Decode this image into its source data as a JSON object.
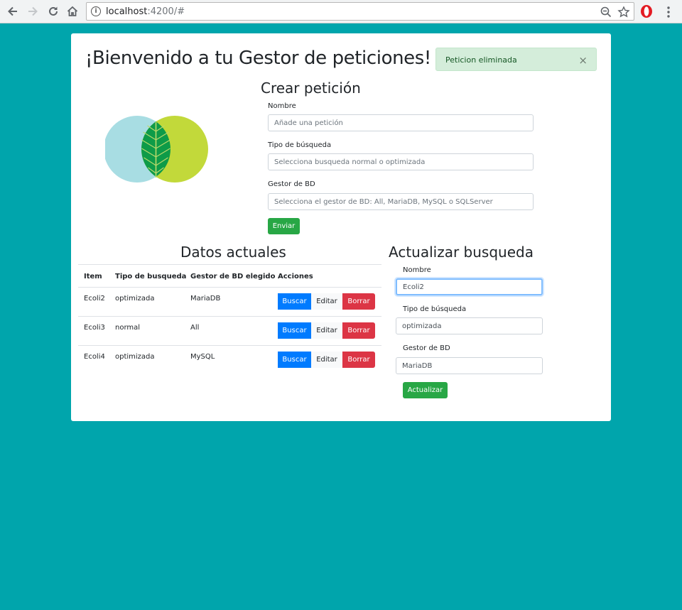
{
  "browser": {
    "url_host": "localhost",
    "url_rest": ":4200/#"
  },
  "header": {
    "title": "¡Bienvenido a tu Gestor de peticiones!"
  },
  "alert": {
    "message": "Peticion eliminada",
    "close": "×"
  },
  "create_form": {
    "title": "Crear petición",
    "name_label": "Nombre",
    "name_placeholder": "Añade una petición",
    "search_type_label": "Tipo de búsqueda",
    "search_type_placeholder": "Selecciona busqueda normal o optimizada",
    "db_label": "Gestor de BD",
    "db_placeholder": "Selecciona el gestor de BD: All, MariaDB, MySQL o SQLServer",
    "submit_label": "Enviar"
  },
  "table": {
    "title": "Datos actuales",
    "headers": [
      "Item",
      "Tipo de busqueda",
      "Gestor de BD elegido",
      "Acciones"
    ],
    "rows": [
      {
        "item": "Ecoli2",
        "tipo": "optimizada",
        "gestor": "MariaDB"
      },
      {
        "item": "Ecoli3",
        "tipo": "normal",
        "gestor": "All"
      },
      {
        "item": "Ecoli4",
        "tipo": "optimizada",
        "gestor": "MySQL"
      }
    ],
    "actions": {
      "search": "Buscar",
      "edit": "Editar",
      "delete": "Borrar"
    }
  },
  "update_form": {
    "title": "Actualizar busqueda",
    "name_label": "Nombre",
    "name_value": "Ecoli2",
    "search_type_label": "Tipo de búsqueda",
    "search_type_value": "optimizada",
    "db_label": "Gestor de BD",
    "db_value": "MariaDB",
    "submit_label": "Actualizar"
  },
  "colors": {
    "page_background": "#00a5ac",
    "success": "#28a745",
    "primary": "#007bff",
    "danger": "#dc3545",
    "alert_background": "#d4edda"
  }
}
